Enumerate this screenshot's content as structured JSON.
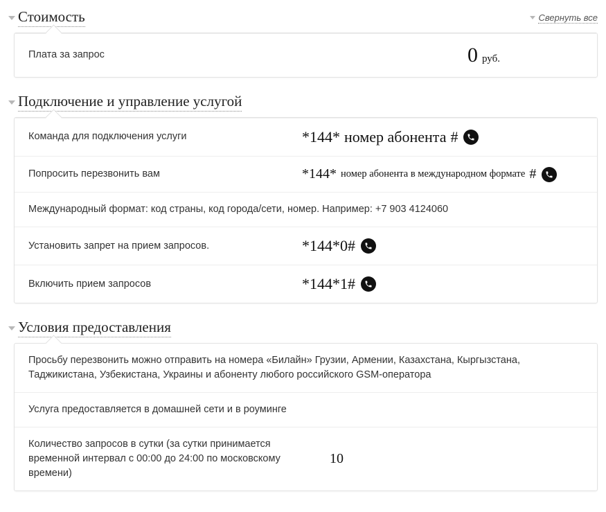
{
  "collapse_all": "Свернуть все",
  "sections": {
    "cost": {
      "title": "Стоимость",
      "fee_label": "Плата за запрос",
      "fee_value": "0",
      "fee_unit": "руб."
    },
    "manage": {
      "title": "Подключение и управление услугой",
      "row1_label": "Команда для подключения услуги",
      "row1_code_a": "*144*",
      "row1_code_b": "номер абонента",
      "row1_code_c": "#",
      "row2_label": "Попросить перезвонить вам",
      "row2_code_a": "*144*",
      "row2_code_b": "номер абонента в международном формате",
      "row2_code_c": "#",
      "row3_text": "Международный формат: код страны, код города/сети, номер. Например: +7 903 4124060",
      "row4_label": "Установить запрет на прием запросов.",
      "row4_code": "*144*0#",
      "row5_label": "Включить прием запросов",
      "row5_code": "*144*1#"
    },
    "terms": {
      "title": "Условия предоставления",
      "row1_text": "Просьбу перезвонить можно отправить на номера «Билайн» Грузии, Армении, Казахстана, Кыргызстана, Таджикистана, Узбекистана, Украины и абоненту любого российского GSM-оператора",
      "row2_text": "Услуга предоставляется в домашней сети и в роуминге",
      "row3_label": "Количество запросов в сутки (за сутки принимается временной интервал с 00:00 до 24:00 по московскому времени)",
      "row3_value": "10"
    }
  }
}
